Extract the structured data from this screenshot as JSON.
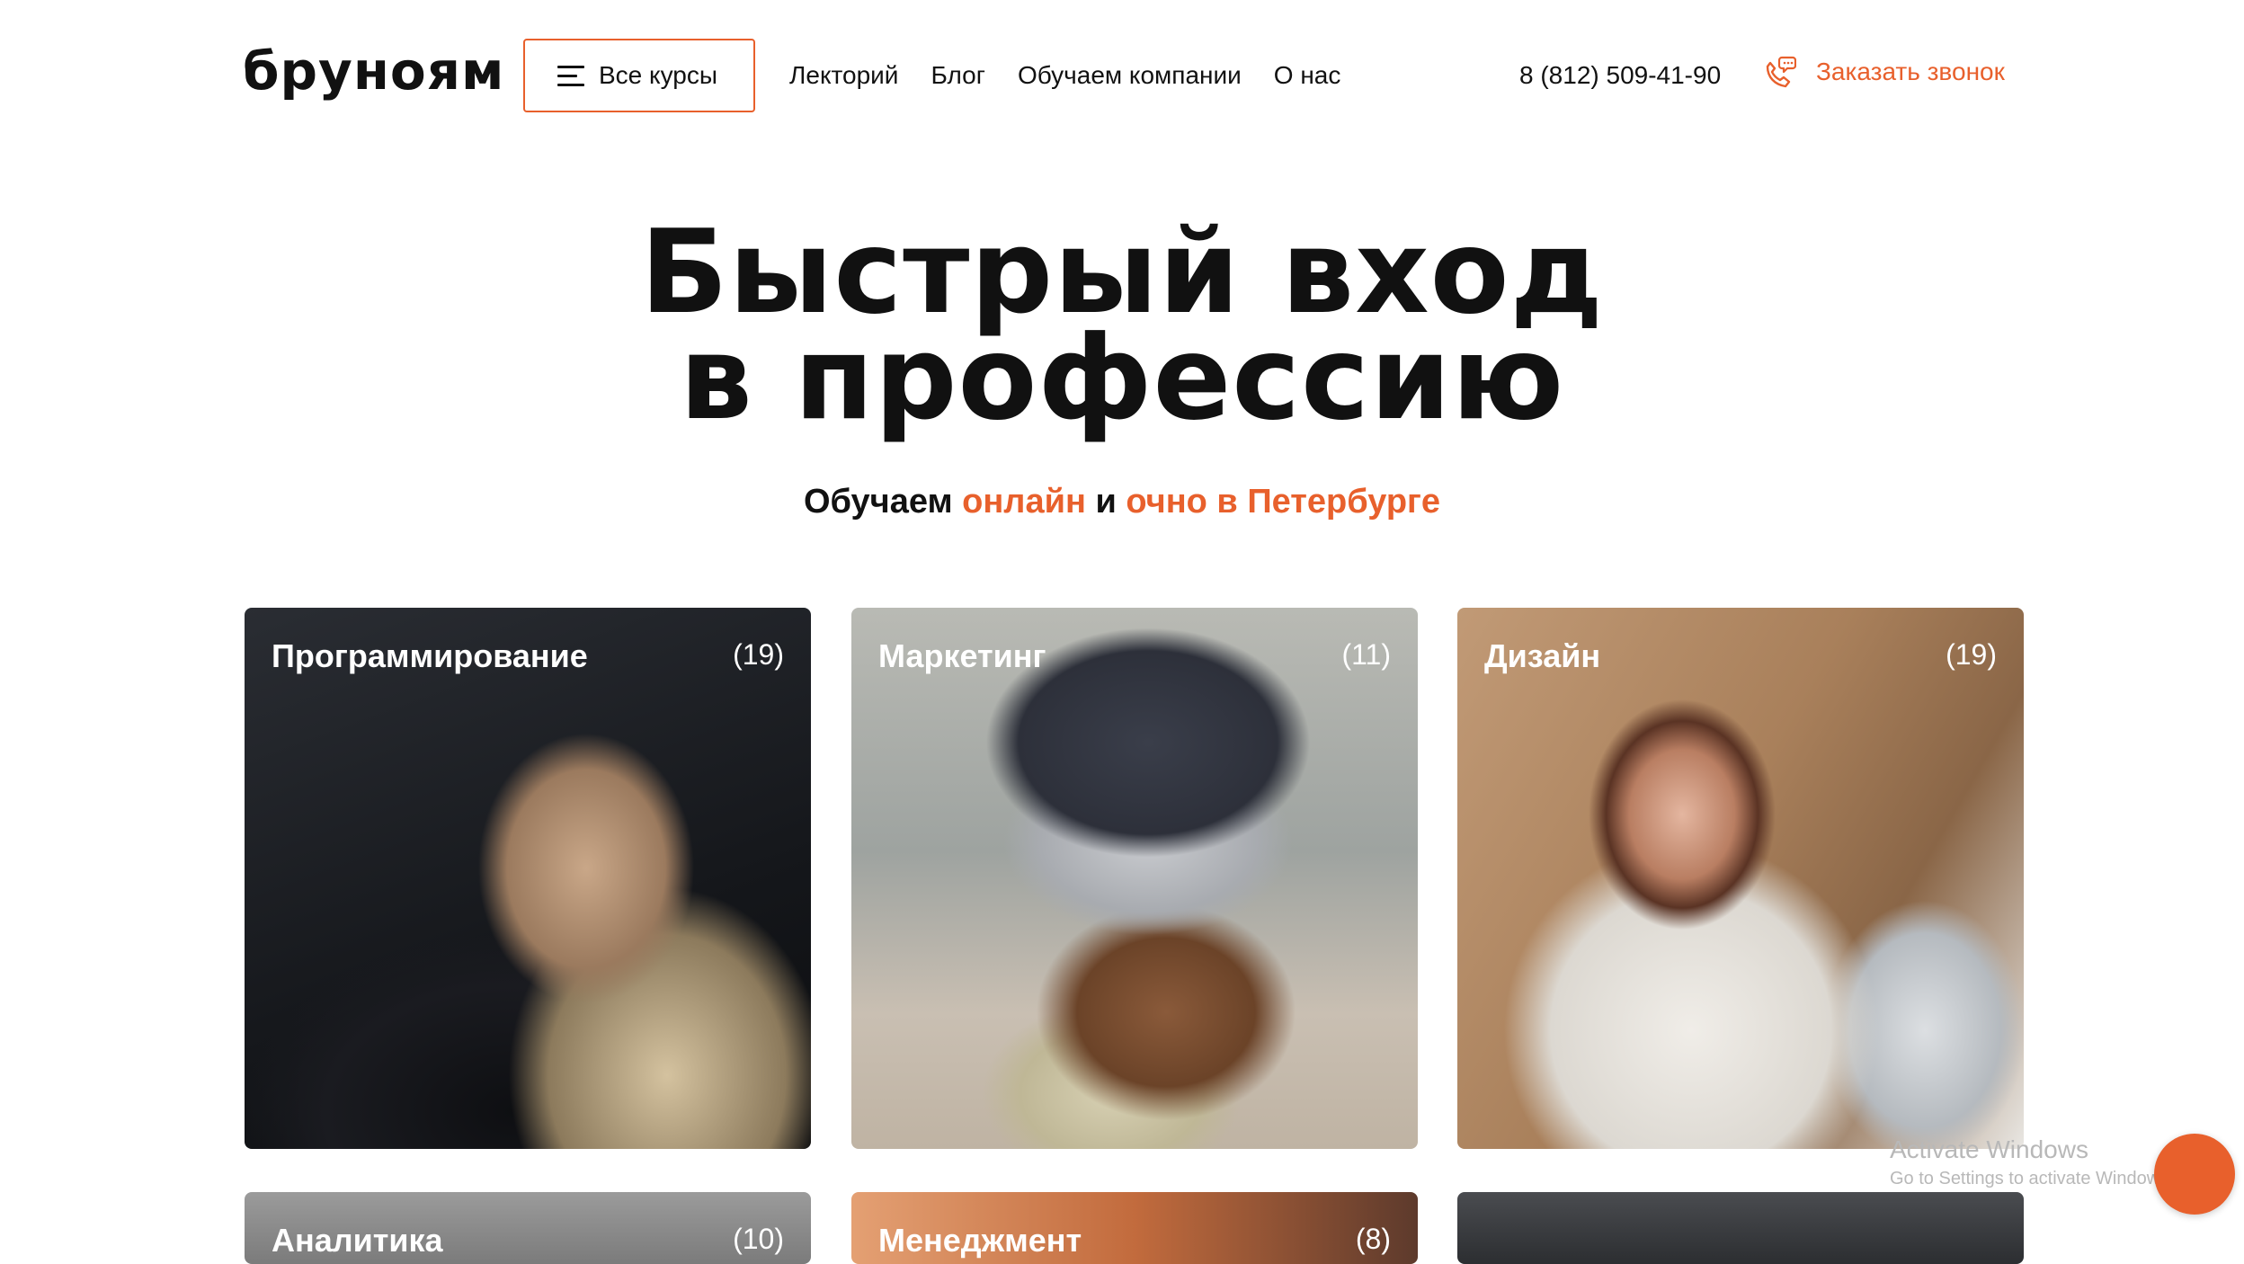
{
  "header": {
    "logo": "бруноям",
    "all_courses_label": "Все курсы",
    "nav": [
      "Лекторий",
      "Блог",
      "Обучаем компании",
      "О нас"
    ],
    "phone": "8 (812) 509-41-90",
    "callback_label": "Заказать звонок"
  },
  "hero": {
    "title_line1": "Быстрый вход",
    "title_line2": "в профессию",
    "sub_part1": "Обучаем ",
    "sub_accent1": "онлайн",
    "sub_part2": " и ",
    "sub_accent2": "очно в Петербурге"
  },
  "categories": [
    {
      "title": "Программирование",
      "count": "(19)"
    },
    {
      "title": "Маркетинг",
      "count": "(11)"
    },
    {
      "title": "Дизайн",
      "count": "(19)"
    },
    {
      "title": "Аналитика",
      "count": "(10)"
    },
    {
      "title": "Менеджмент",
      "count": "(8)"
    },
    {
      "title": "",
      "count": ""
    }
  ],
  "watermark": {
    "line1": "Activate Windows",
    "line2": "Go to Settings to activate Windows."
  },
  "colors": {
    "accent": "#e8602c",
    "text": "#111111",
    "background": "#ffffff"
  },
  "icons": [
    "menu-icon",
    "phone-chat-icon"
  ]
}
